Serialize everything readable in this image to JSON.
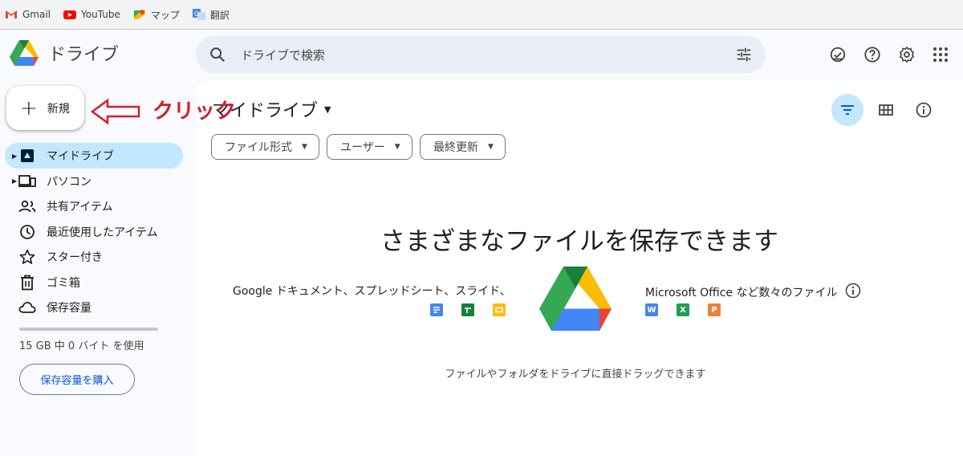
{
  "bookmarks": [
    {
      "label": "Gmail",
      "icon": "gmail-icon"
    },
    {
      "label": "YouTube",
      "icon": "youtube-icon"
    },
    {
      "label": "マップ",
      "icon": "maps-icon"
    },
    {
      "label": "翻訳",
      "icon": "translate-icon"
    }
  ],
  "header": {
    "app_name": "ドライブ",
    "search_placeholder": "ドライブで検索"
  },
  "new_button": {
    "label": "新規"
  },
  "annotation": {
    "text": "クリック",
    "color": "#d0202e"
  },
  "sidebar": {
    "items": [
      {
        "label": "マイドライブ",
        "icon": "my-drive-icon",
        "active": true,
        "expandable": true
      },
      {
        "label": "パソコン",
        "icon": "computers-icon",
        "expandable": true
      },
      {
        "label": "共有アイテム",
        "icon": "shared-icon"
      },
      {
        "label": "最近使用したアイテム",
        "icon": "clock-icon"
      },
      {
        "label": "スター付き",
        "icon": "star-icon"
      },
      {
        "label": "ゴミ箱",
        "icon": "trash-icon"
      },
      {
        "label": "保存容量",
        "icon": "cloud-icon"
      }
    ],
    "storage_used_fraction": 0,
    "storage_text": "15 GB 中 0 バイト を使用",
    "buy_storage_label": "保存容量を購入"
  },
  "main": {
    "title": "マイドライブ",
    "filters": [
      "ファイル形式",
      "ユーザー",
      "最終更新"
    ],
    "empty_title": "さまざまなファイルを保存できます",
    "left_caption": "Google ドキュメント、スプレッドシート、スライド、",
    "right_caption": "Microsoft Office など数々のファイル",
    "office_letters": [
      "W",
      "X",
      "P"
    ],
    "drag_hint": "ファイルやフォルダをドライブに直接ドラッグできます"
  },
  "colors": {
    "accent": "#0b57d0",
    "active_nav": "#c2e7ff",
    "annotation_red": "#d0202e"
  }
}
